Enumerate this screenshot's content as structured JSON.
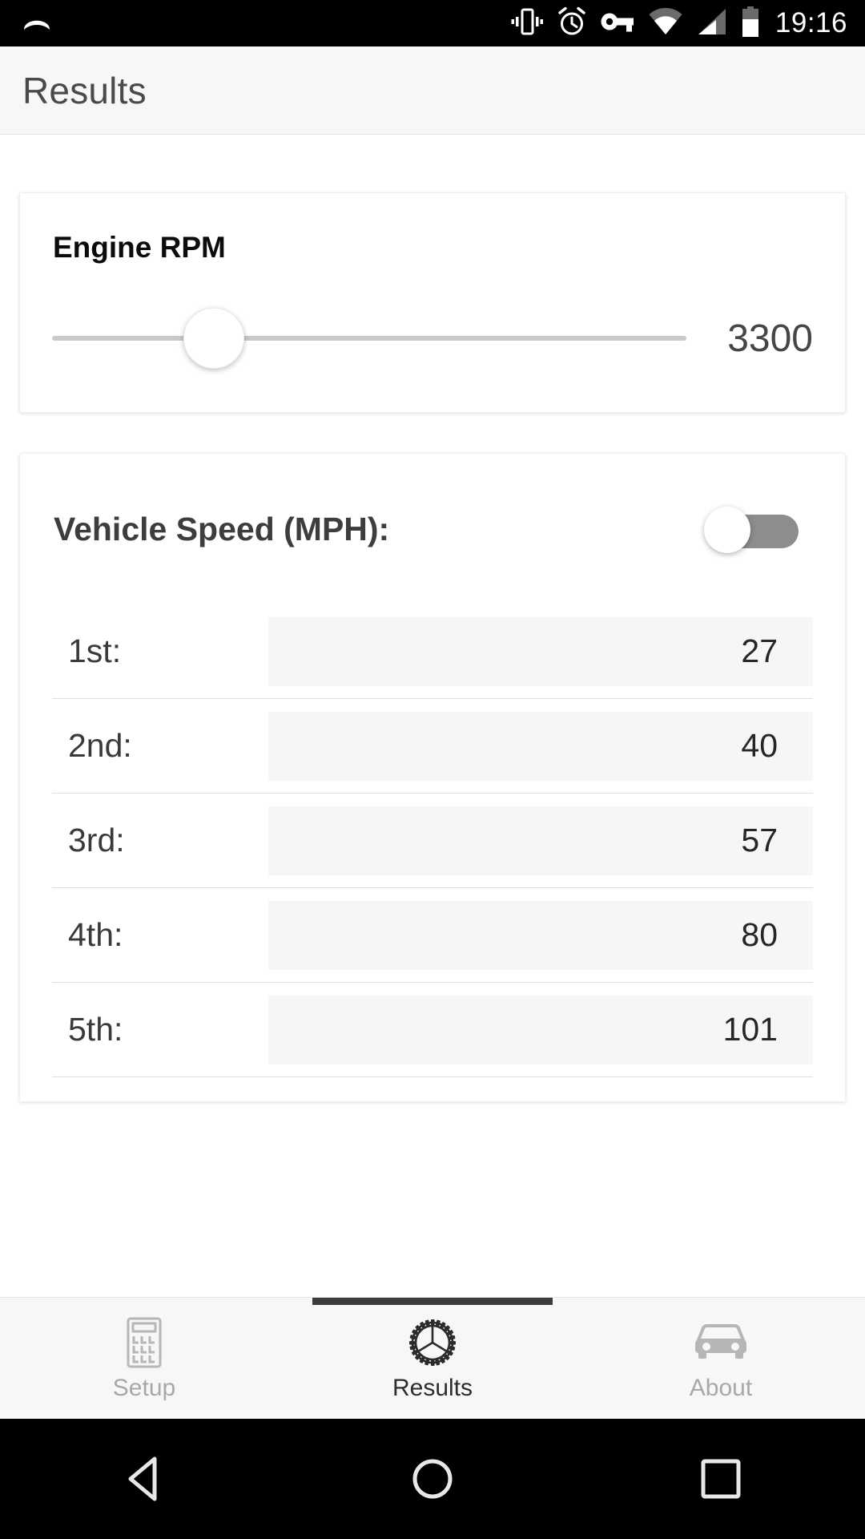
{
  "status_bar": {
    "time": "19:16",
    "icons": [
      {
        "name": "notification-swipe-icon"
      },
      {
        "name": "vibrate-icon"
      },
      {
        "name": "alarm-icon"
      },
      {
        "name": "vpn-key-icon"
      },
      {
        "name": "wifi-icon"
      },
      {
        "name": "cellular-signal-icon"
      },
      {
        "name": "battery-icon"
      }
    ]
  },
  "app_bar": {
    "title": "Results"
  },
  "rpm_card": {
    "title": "Engine RPM",
    "value": "3300",
    "slider_position_percent": 25.5
  },
  "speed_card": {
    "label": "Vehicle Speed (MPH):",
    "toggle_state": "off",
    "gears": [
      {
        "label": "1st:",
        "value": "27"
      },
      {
        "label": "2nd:",
        "value": "40"
      },
      {
        "label": "3rd:",
        "value": "57"
      },
      {
        "label": "4th:",
        "value": "80"
      },
      {
        "label": "5th:",
        "value": "101"
      }
    ]
  },
  "tab_bar": {
    "tabs": [
      {
        "label": "Setup",
        "icon": "calculator-icon",
        "active": false
      },
      {
        "label": "Results",
        "icon": "gear-icon",
        "active": true
      },
      {
        "label": "About",
        "icon": "car-icon",
        "active": false
      }
    ]
  },
  "nav_bar": {
    "buttons": [
      {
        "name": "back-button"
      },
      {
        "name": "home-button"
      },
      {
        "name": "recents-button"
      }
    ]
  },
  "colors": {
    "status_bar_bg": "#000000",
    "app_bar_bg": "#f7f7f7",
    "accent_dark": "#3b3b3b",
    "field_bg": "#f6f6f6",
    "toggle_track": "#8d8d8d",
    "inactive_tab": "#a8a8a8"
  }
}
